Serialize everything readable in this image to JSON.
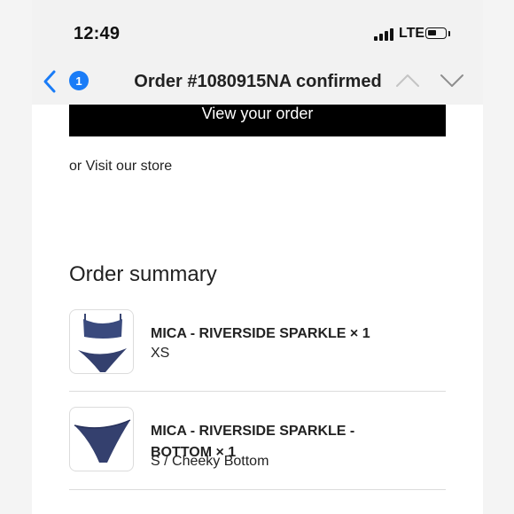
{
  "status_bar": {
    "time": "12:49",
    "network": "LTE",
    "icons": [
      "signal-bars-icon",
      "battery-icon"
    ]
  },
  "nav": {
    "unread_count": "1",
    "title": "Order #1080915NA confirmed",
    "icons": [
      "chevron-left-icon",
      "chevron-up-icon",
      "chevron-down-icon"
    ],
    "accent_color": "#1a7cf7"
  },
  "content": {
    "view_order_label": "View your order",
    "visit_store_prefix": "or ",
    "visit_store_label": "Visit our store",
    "order_summary_heading": "Order summary",
    "items": [
      {
        "title": "MICA - RIVERSIDE SPARKLE × 1",
        "variant": "XS",
        "image": "bikini-set-thumbnail"
      },
      {
        "title": "MICA - RIVERSIDE SPARKLE - BOTTOM × 1",
        "variant": "S / Cheeky Bottom",
        "image": "bikini-bottom-thumbnail"
      }
    ]
  }
}
